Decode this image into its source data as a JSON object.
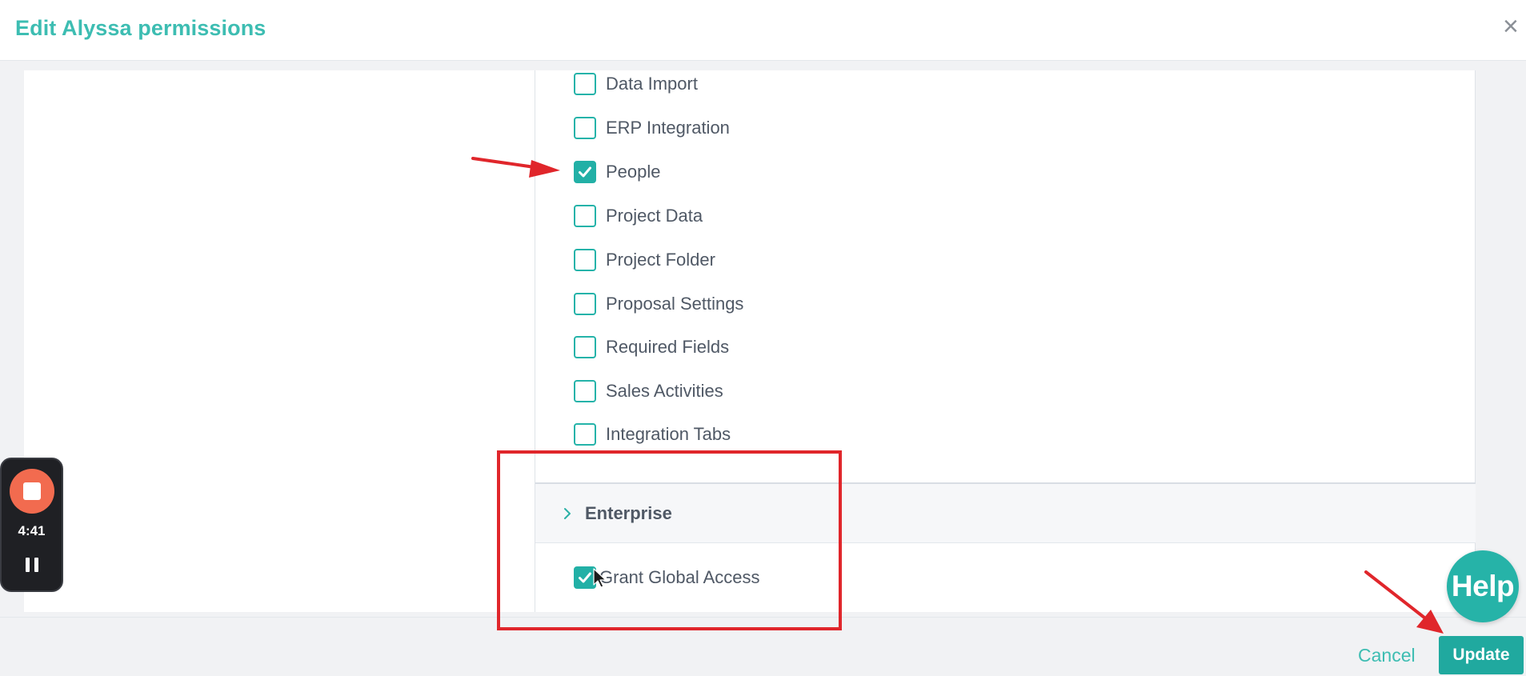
{
  "modal": {
    "title": "Edit Alyssa permissions",
    "close_glyph": "×"
  },
  "permissions": [
    {
      "label": "Data Import",
      "checked": false
    },
    {
      "label": "ERP Integration",
      "checked": false
    },
    {
      "label": "People",
      "checked": true
    },
    {
      "label": "Project Data",
      "checked": false
    },
    {
      "label": "Project Folder",
      "checked": false
    },
    {
      "label": "Proposal Settings",
      "checked": false
    },
    {
      "label": "Required Fields",
      "checked": false
    },
    {
      "label": "Sales Activities",
      "checked": false
    },
    {
      "label": "Integration Tabs",
      "checked": false
    }
  ],
  "enterprise": {
    "section_label": "Enterprise",
    "grant_global_access": {
      "label": "Grant Global Access",
      "checked": true
    }
  },
  "footer": {
    "cancel_label": "Cancel",
    "update_label": "Update"
  },
  "help": {
    "label": "Help"
  },
  "recorder": {
    "time": "4:41"
  },
  "colors": {
    "accent": "#3dbdb2",
    "button": "#20a99f",
    "checkbox": "#25b3a9",
    "annotation": "#e0262b",
    "recorder_stop": "#f26b4f"
  }
}
